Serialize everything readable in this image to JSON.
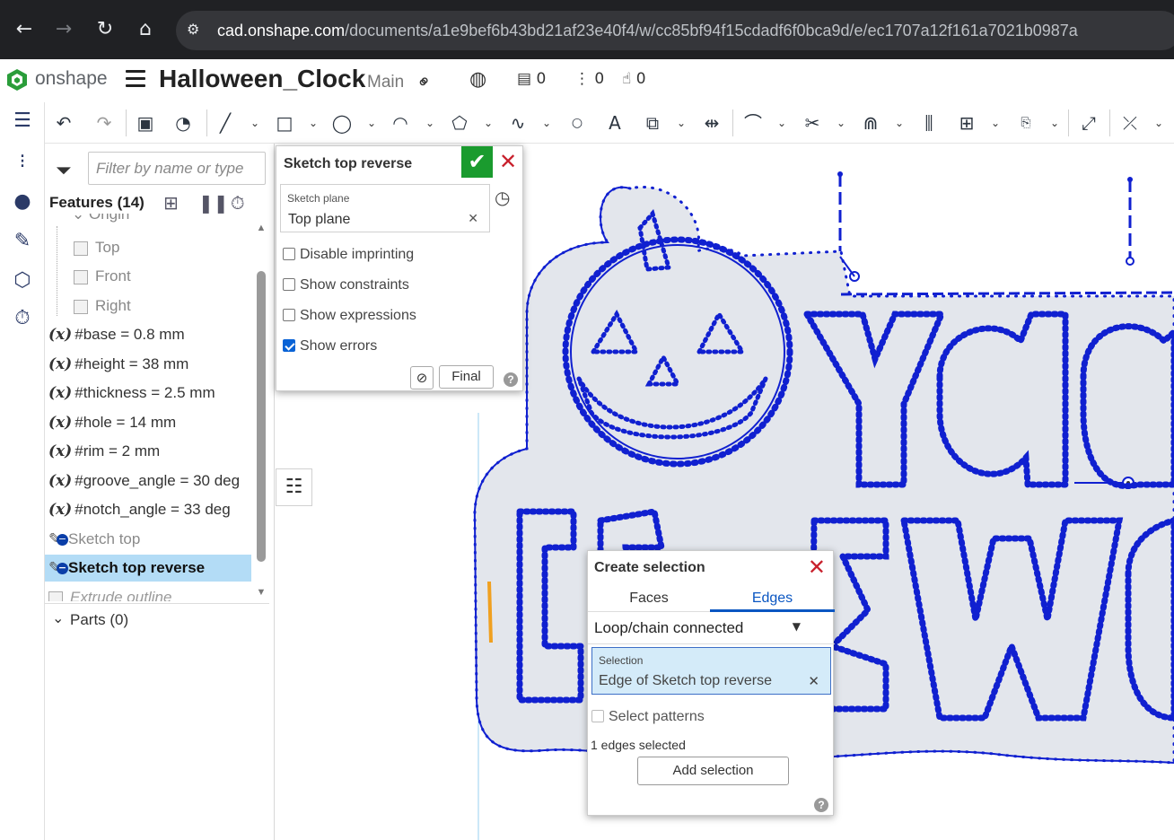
{
  "browser": {
    "url_host": "cad.onshape.com",
    "url_path": "/documents/a1e9bef6b43bd21af23e40f4/w/cc85bf94f15cdadf6f0bca9d/e/ec1707a12f161a7021b0987a"
  },
  "header": {
    "brand": "onshape",
    "doc_title": "Halloween_Clock",
    "branch": "Main",
    "versions_count": "0",
    "branches_count": "0",
    "likes_count": "0"
  },
  "features": {
    "filter_placeholder": "Filter by name or type",
    "title": "Features (14)",
    "items": [
      {
        "label": "Origin"
      },
      {
        "label": "Top"
      },
      {
        "label": "Front"
      },
      {
        "label": "Right"
      },
      {
        "label": "#base = 0.8 mm"
      },
      {
        "label": "#height = 38 mm"
      },
      {
        "label": "#thickness = 2.5 mm"
      },
      {
        "label": "#hole = 14 mm"
      },
      {
        "label": "#rim = 2 mm"
      },
      {
        "label": "#groove_angle = 30 deg"
      },
      {
        "label": "#notch_angle = 33 deg"
      },
      {
        "label": "Sketch top"
      },
      {
        "label": "Sketch top reverse"
      },
      {
        "label": "Extrude outline"
      }
    ],
    "parts_label": "Parts (0)"
  },
  "sketch_dialog": {
    "title": "Sketch top reverse",
    "plane_label": "Sketch plane",
    "plane_value": "Top plane",
    "options": [
      {
        "label": "Disable imprinting",
        "checked": false
      },
      {
        "label": "Show constraints",
        "checked": false
      },
      {
        "label": "Show expressions",
        "checked": false
      },
      {
        "label": "Show errors",
        "checked": true
      }
    ],
    "final_label": "Final",
    "help": "?"
  },
  "selection_dialog": {
    "title": "Create selection",
    "tab_faces": "Faces",
    "tab_edges": "Edges",
    "mode": "Loop/chain connected",
    "selection_label": "Selection",
    "selection_value": "Edge of Sketch top reverse",
    "select_patterns": "Select patterns",
    "count_text": "1 edges selected",
    "add_button": "Add selection",
    "help": "?"
  },
  "colors": {
    "sketch_blue": "#1020d0",
    "region_fill": "#e3e6ec",
    "selected_edge": "#f0a020",
    "accept_green": "#1a9b2e"
  }
}
